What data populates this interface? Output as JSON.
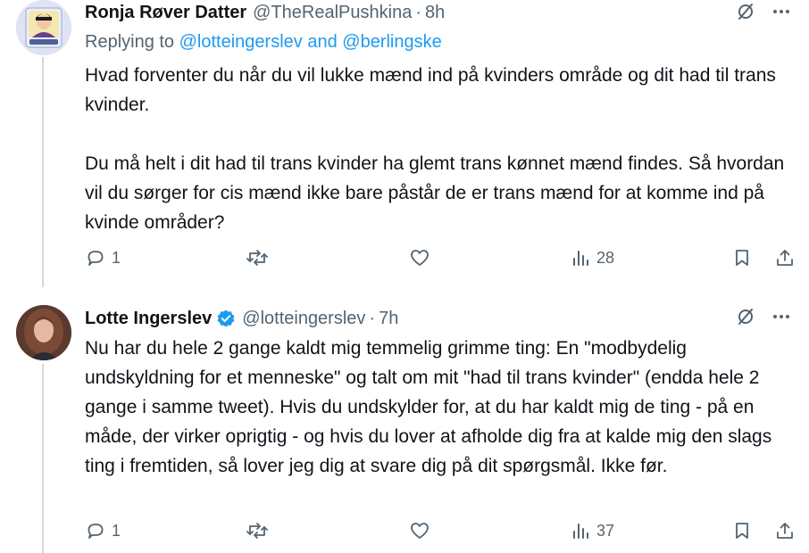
{
  "tweets": [
    {
      "author_name": "Ronja Røver Datter",
      "handle": "@TheRealPushkina",
      "separator": "·",
      "time": "8h",
      "replying_prefix": "Replying to",
      "replying_mention_1": "@lotteingerslev",
      "replying_and": "and",
      "replying_mention_2": "@berlingske",
      "paragraphs": [
        "Hvad forventer du når du vil lukke mænd ind på kvinders område og dit had til trans kvinder.",
        "Du må helt i dit had til trans kvinder ha glemt trans kønnet mænd findes. Så hvordan vil du sørger for cis mænd ikke bare påstår de er trans mænd for at komme ind på kvinde områder?"
      ],
      "replies": "1",
      "views": "28",
      "more_label": "···"
    },
    {
      "author_name": "Lotte Ingerslev",
      "handle": "@lotteingerslev",
      "separator": "·",
      "time": "7h",
      "paragraphs": [
        "Nu har du hele 2 gange kaldt mig temmelig grimme ting: En \"modbydelig undskyldning for et menneske\" og talt om mit \"had til trans kvinder\" (endda hele 2 gange i samme tweet). Hvis du undskylder for, at du har kaldt mig de ting - på en måde, der virker oprigtig - og hvis du lover at afholde dig fra at kalde mig den slags ting i fremtiden, så lover jeg dig at svare dig på dit spørgsmål. Ikke før."
      ],
      "replies": "1",
      "views": "37",
      "more_label": "···"
    }
  ],
  "colors": {
    "text_primary": "#0f1419",
    "text_secondary": "#536471",
    "link": "#1d9bf0",
    "verified": "#1d9bf0",
    "thread_line": "#cfd9de"
  },
  "icons": [
    "grok-icon",
    "more-icon",
    "reply-icon",
    "retweet-icon",
    "like-icon",
    "views-icon",
    "bookmark-icon",
    "share-icon",
    "verified-badge-icon"
  ]
}
